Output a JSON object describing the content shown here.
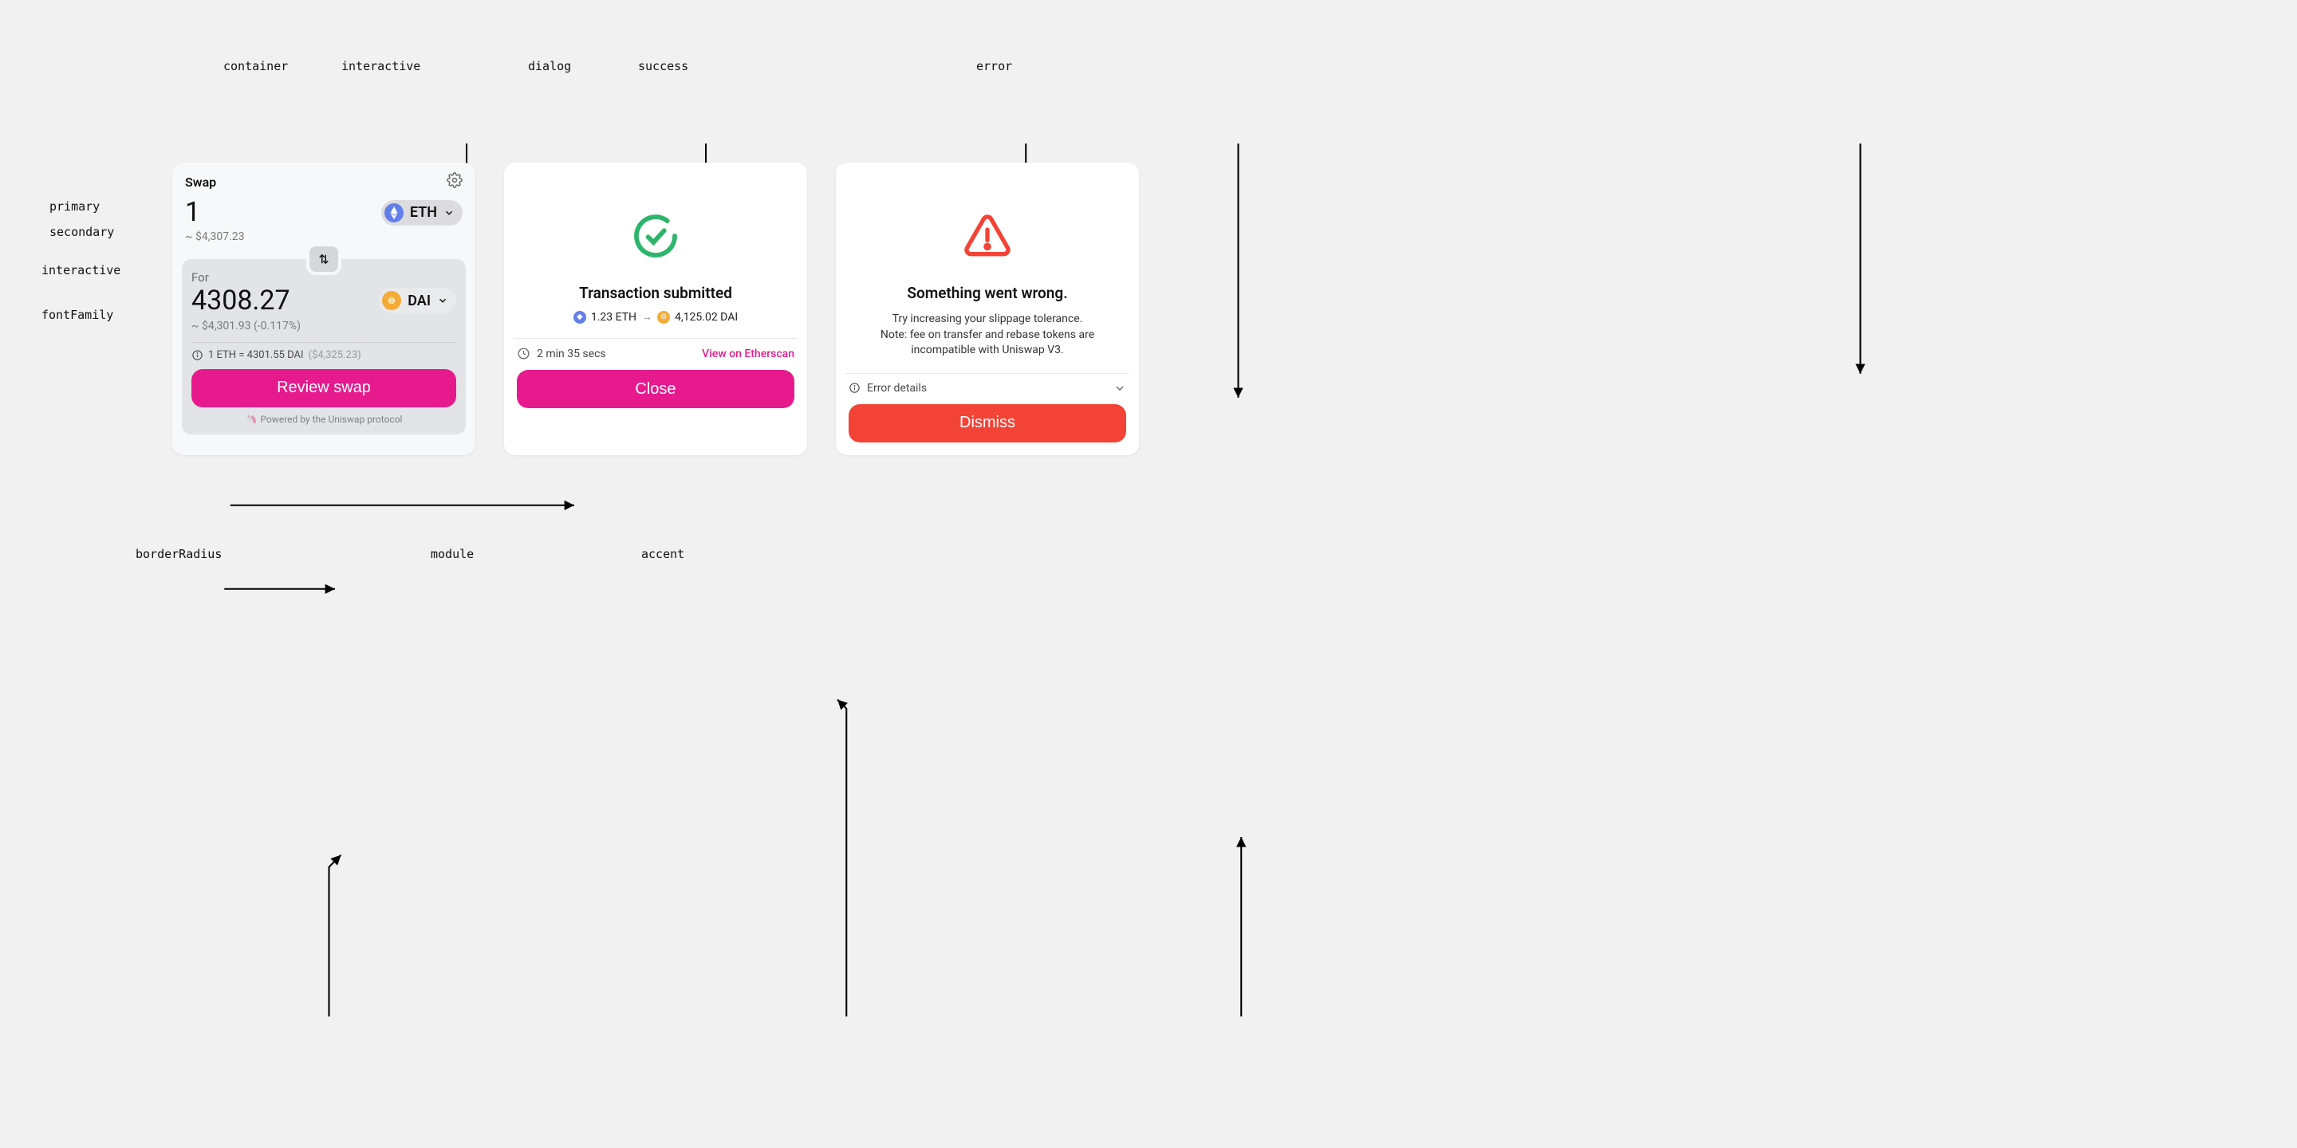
{
  "annotations": {
    "container": "container",
    "interactive": "interactive",
    "dialog": "dialog",
    "success": "success",
    "error": "error",
    "primary": "primary",
    "secondary": "secondary",
    "interactive2": "interactive",
    "fontFamily": "fontFamily",
    "borderRadius": "borderRadius",
    "module": "module",
    "accent": "accent"
  },
  "swap": {
    "title": "Swap",
    "fromAmount": "1",
    "fromToken": "ETH",
    "fromUsd": "~ $4,307.23",
    "forLabel": "For",
    "toAmount": "4308.27",
    "toToken": "DAI",
    "toUsd": "~ $4,301.93 (-0.117%)",
    "rate": "1 ETH = 4301.55 DAI",
    "rateUsd": "($4,325.23)",
    "review": "Review swap",
    "powered": "Powered by the Uniswap protocol"
  },
  "successDialog": {
    "title": "Transaction submitted",
    "fromAmt": "1.23 ETH",
    "toAmt": "4,125.02 DAI",
    "duration": "2 min 35 secs",
    "link": "View on Etherscan",
    "close": "Close"
  },
  "errorDialog": {
    "title": "Something went wrong.",
    "body1": "Try increasing your slippage tolerance.",
    "body2": "Note: fee on transfer and rebase tokens are",
    "body3": "incompatible with Uniswap V3.",
    "details": "Error details",
    "dismiss": "Dismiss"
  }
}
